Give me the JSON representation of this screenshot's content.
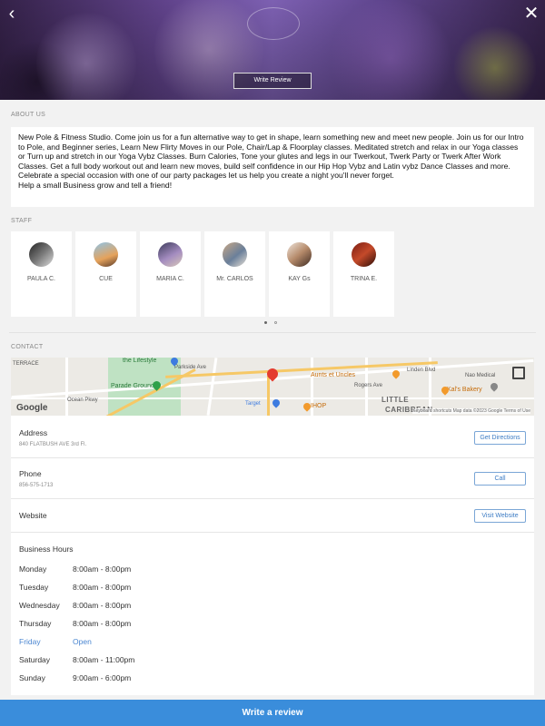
{
  "hero": {
    "write_review_label": "Write Review"
  },
  "about": {
    "section_label": "ABOUT US",
    "text_lines": [
      "New Pole & Fitness Studio. Come join us for a fun alternative way to get in shape, learn something new and meet new people. Join us for our Intro to Pole, and Beginner series, Learn New Flirty Moves in our Pole, Chair/Lap & Floorplay classes. Meditated stretch and relax in our Yoga classes or Turn up and stretch in our Yoga Vybz Classes. Burn Calories, Tone your glutes and legs in our Twerkout, Twerk Party or Twerk After Work Classes. Get a full body workout out and learn new moves, build self confidence in our Hip Hop Vybz and Latin vybz Dance Classes and more.",
      "Celebrate a special occasion with one of our party packages let us help you create a night you'll never forget.",
      "Help a small Business grow and tell a friend!"
    ]
  },
  "staff": {
    "section_label": "STAFF",
    "members": [
      {
        "name": "PAULA C."
      },
      {
        "name": "CUE"
      },
      {
        "name": "MARIA C."
      },
      {
        "name": "Mr. CARLOS"
      },
      {
        "name": "KAY Gs"
      },
      {
        "name": "TRINA E."
      }
    ]
  },
  "contact": {
    "section_label": "CONTACT",
    "map": {
      "labels": {
        "parkside": "Parkside Ave",
        "parade": "Parade Ground",
        "linden": "Linden Blvd",
        "aunts": "Aunts et Uncles",
        "kals": "Kal's Bakery",
        "nao": "Nao Medical",
        "little": "LITTLE",
        "caribbean": "CARIBBEAN",
        "target": "Target",
        "ihop": "IHOP",
        "terrace": "TERRACE",
        "lifestyle": "the Lifestyle",
        "ocean": "Ocean Pkwy",
        "rogers": "Rogers Ave",
        "google": "Google"
      },
      "footer": "Keyboard shortcuts  Map data ©2023 Google  Terms of Use"
    },
    "address": {
      "label": "Address",
      "value": "840 FLATBUSH AVE 3rd Fl.",
      "button": "Get Directions"
    },
    "phone": {
      "label": "Phone",
      "value": "856-575-1713",
      "button": "Call"
    },
    "website": {
      "label": "Website",
      "button": "Visit Website"
    },
    "hours": {
      "title": "Business Hours",
      "days": [
        {
          "day": "Monday",
          "time": "8:00am - 8:00pm"
        },
        {
          "day": "Tuesday",
          "time": "8:00am - 8:00pm"
        },
        {
          "day": "Wednesday",
          "time": "8:00am - 8:00pm"
        },
        {
          "day": "Thursday",
          "time": "8:00am - 8:00pm"
        },
        {
          "day": "Friday",
          "time": "Open"
        },
        {
          "day": "Saturday",
          "time": "8:00am - 11:00pm"
        },
        {
          "day": "Sunday",
          "time": "9:00am - 6:00pm"
        }
      ]
    }
  },
  "bottom_bar": {
    "label": "Write a review"
  },
  "colors": {
    "accent": "#3a8ddb",
    "link": "#3d7cc4",
    "today": "#4a86d1"
  }
}
